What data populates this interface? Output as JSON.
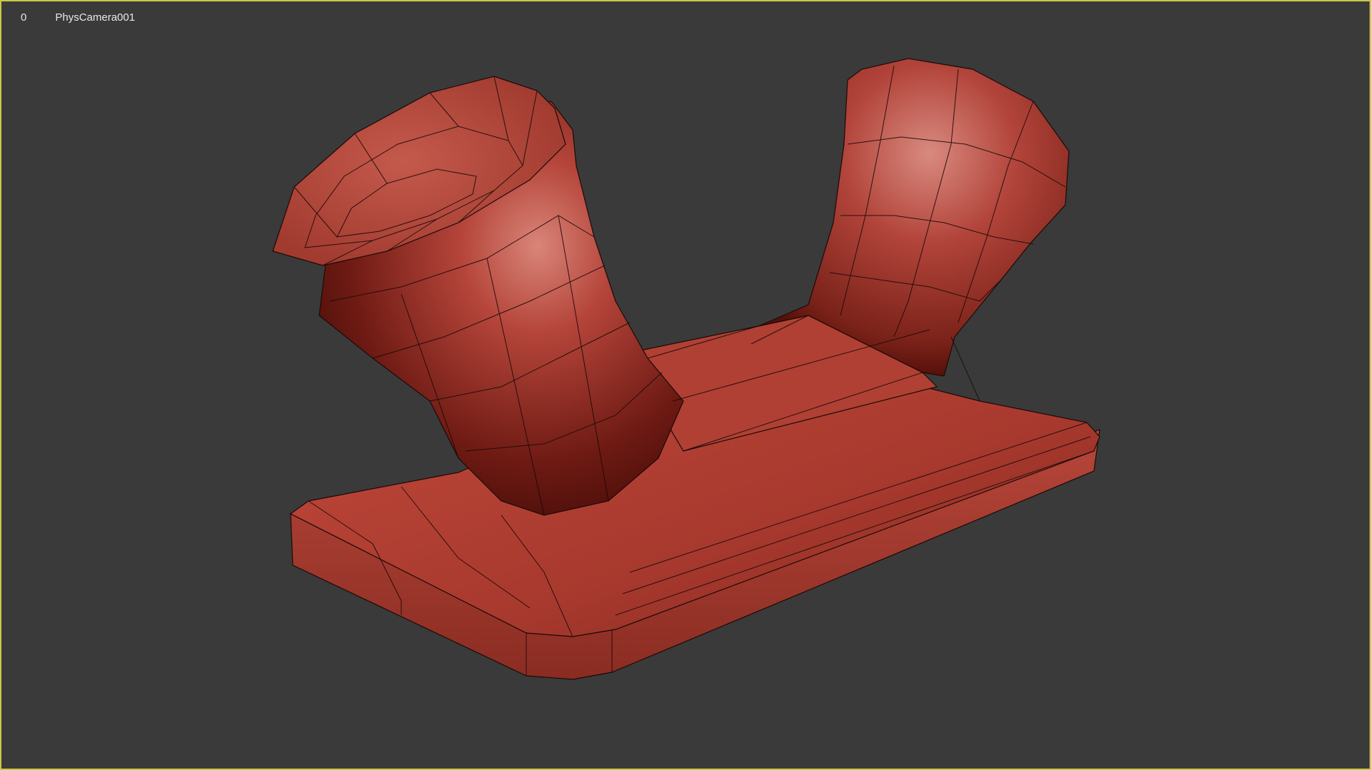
{
  "viewport": {
    "frame_number": "0",
    "camera_name": "PhysCamera001",
    "border_color": "#c8c845",
    "background_color": "#3a3a3a"
  },
  "model": {
    "color": "#b84033",
    "highlight_color": "#d87a72",
    "shadow_color": "#5a120d",
    "wire_color": "#1a0a08"
  }
}
